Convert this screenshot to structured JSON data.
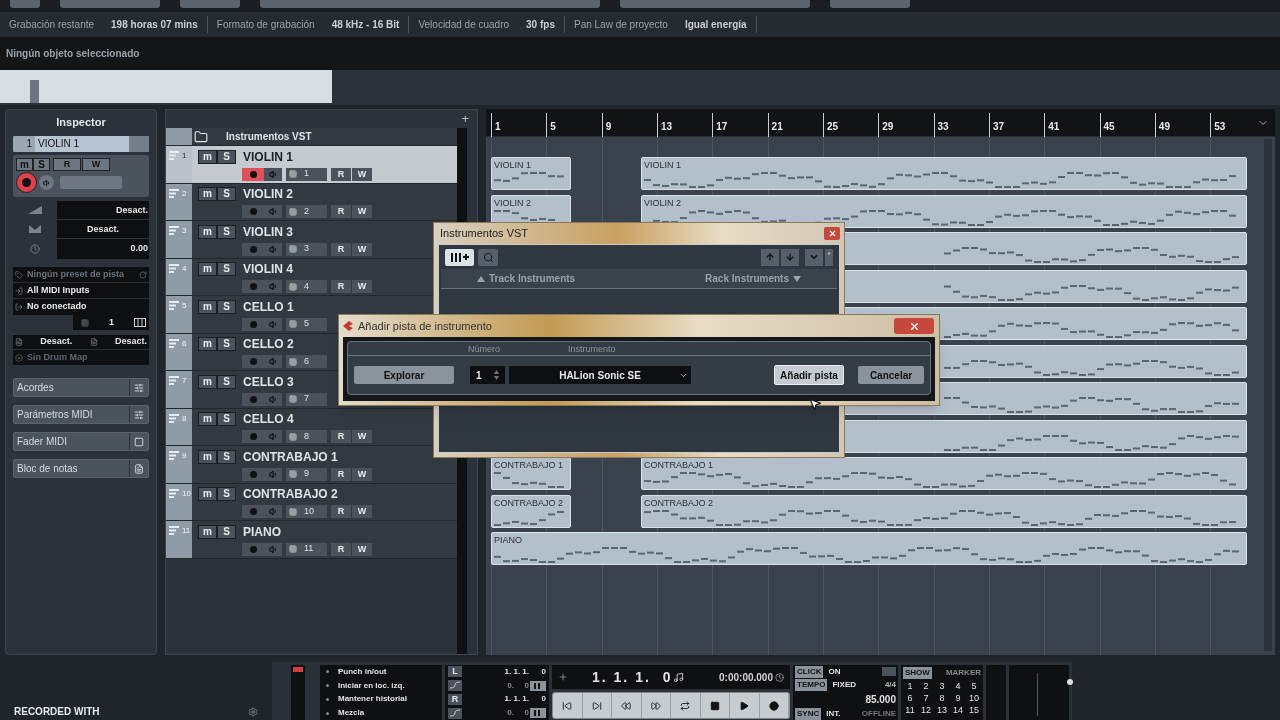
{
  "info_bar": [
    {
      "label": "Grabación restante",
      "value": "198 horas 07 mins"
    },
    {
      "label": "Formato de grabación",
      "value": "48 kHz - 16 Bit"
    },
    {
      "label": "Velocidad de cuadro",
      "value": "30 fps"
    },
    {
      "label": "Pan Law de proyecto",
      "value": "Igual energía"
    }
  ],
  "selection_info": "Ningún objeto seleccionado",
  "inspector": {
    "title": "Inspector",
    "track_number": "1",
    "track_name": "VIOLIN 1",
    "buttons": {
      "mute": "m",
      "solo": "S",
      "read": "R",
      "write": "W"
    },
    "record_armed": true,
    "volume": "Desact.",
    "pan": "Desact.",
    "delay": "0.00",
    "preset": "Ningún preset de pista",
    "input": "All MIDI Inputs",
    "output": "No conectado",
    "channel": "1",
    "bank": "Desact.",
    "program": "Desact.",
    "drum_map": "Sin Drum Map",
    "sections": [
      "Acordes",
      "Parámetros MIDI",
      "Fader MIDI",
      "Bloc de notas"
    ]
  },
  "track_list": {
    "add": "+",
    "folder": "Instrumentos VST",
    "tracks": [
      {
        "number": "1",
        "name": "VIOLIN 1",
        "channel": "1",
        "selected": true,
        "record_armed": true,
        "buttons": {
          "mute": "m",
          "solo": "S",
          "read": "R",
          "write": "W"
        }
      },
      {
        "number": "2",
        "name": "VIOLIN 2",
        "channel": "2",
        "selected": false,
        "record_armed": false,
        "buttons": {
          "mute": "m",
          "solo": "S",
          "read": "R",
          "write": "W"
        }
      },
      {
        "number": "3",
        "name": "VIOLIN 3",
        "channel": "3",
        "selected": false,
        "record_armed": false,
        "buttons": {
          "mute": "m",
          "solo": "S",
          "read": "R",
          "write": "W"
        }
      },
      {
        "number": "4",
        "name": "VIOLIN 4",
        "channel": "4",
        "selected": false,
        "record_armed": false,
        "buttons": {
          "mute": "m",
          "solo": "S",
          "read": "R",
          "write": "W"
        }
      },
      {
        "number": "5",
        "name": "CELLO 1",
        "channel": "5",
        "selected": false,
        "record_armed": false,
        "buttons": {
          "mute": "m",
          "solo": "S"
        }
      },
      {
        "number": "6",
        "name": "CELLO 2",
        "channel": "6",
        "selected": false,
        "record_armed": false,
        "buttons": {
          "mute": "m",
          "solo": "S"
        }
      },
      {
        "number": "7",
        "name": "CELLO 3",
        "channel": "7",
        "selected": false,
        "record_armed": false,
        "buttons": {
          "mute": "m",
          "solo": "S"
        }
      },
      {
        "number": "8",
        "name": "CELLO 4",
        "channel": "8",
        "selected": false,
        "record_armed": false,
        "buttons": {
          "mute": "m",
          "solo": "S",
          "read": "R",
          "write": "W"
        }
      },
      {
        "number": "9",
        "name": "CONTRABAJO 1",
        "channel": "9",
        "selected": false,
        "record_armed": false,
        "buttons": {
          "mute": "m",
          "solo": "S",
          "read": "R",
          "write": "W"
        }
      },
      {
        "number": "10",
        "name": "CONTRABAJO 2",
        "channel": "10",
        "selected": false,
        "record_armed": false,
        "buttons": {
          "mute": "m",
          "solo": "S",
          "read": "R",
          "write": "W"
        }
      },
      {
        "number": "11",
        "name": "PIANO",
        "channel": "11",
        "selected": false,
        "record_armed": false,
        "buttons": {
          "mute": "m",
          "solo": "S",
          "read": "R",
          "write": "W"
        }
      }
    ]
  },
  "arrange": {
    "ruler": [
      "1",
      "5",
      "9",
      "13",
      "17",
      "21",
      "25",
      "29",
      "33",
      "37",
      "41",
      "45",
      "49",
      "53"
    ],
    "lanes": [
      {
        "clips": [
          {
            "kind": "intro",
            "name": "VIOLIN 1"
          },
          {
            "kind": "main",
            "name": "VIOLIN 1"
          }
        ]
      },
      {
        "clips": [
          {
            "kind": "intro",
            "name": "VIOLIN 2"
          },
          {
            "kind": "main",
            "name": "VIOLIN 2"
          }
        ]
      },
      {
        "clips": [
          {
            "kind": "main"
          }
        ]
      },
      {
        "clips": [
          {
            "kind": "main"
          }
        ]
      },
      {
        "clips": [
          {
            "kind": "main"
          }
        ]
      },
      {
        "clips": [
          {
            "kind": "main"
          }
        ]
      },
      {
        "clips": [
          {
            "kind": "main"
          }
        ]
      },
      {
        "clips": [
          {
            "kind": "main"
          }
        ]
      },
      {
        "clips": [
          {
            "kind": "intro",
            "name": "CONTRABAJO 1"
          },
          {
            "kind": "main",
            "name": "CONTRABAJO 1"
          }
        ]
      },
      {
        "clips": [
          {
            "kind": "intro",
            "name": "CONTRABAJO 2"
          },
          {
            "kind": "main",
            "name": "CONTRABAJO 2"
          }
        ]
      },
      {
        "clips": [
          {
            "kind": "full",
            "name": "PIANO"
          }
        ]
      }
    ]
  },
  "vst_window": {
    "title": "Instrumentos VST",
    "columns": [
      "Track Instruments",
      "Rack Instruments"
    ],
    "menu_mark": "*"
  },
  "add_track_dialog": {
    "title": "Añadir pista de instrumento",
    "number_label": "Número",
    "instrument_label": "Instrumento",
    "browse": "Explorar",
    "number": "1",
    "instrument": "HALion Sonic SE",
    "add": "Añadir pista",
    "cancel": "Cancelar"
  },
  "transport": {
    "punch": [
      "Punch in/out",
      "Iniciar en loc. izq.",
      "Mantener historial",
      "Mezcla"
    ],
    "locators": [
      {
        "label": "L",
        "position": "1. 1. 1.",
        "ticks": "0",
        "sub": "0.",
        "sub_ticks": "0"
      },
      {
        "label": "R",
        "position": "1. 1. 1.",
        "ticks": "0",
        "sub": "0.",
        "sub_ticks": "0"
      }
    ],
    "position": "1. 1. 1.",
    "position_ticks": "0",
    "time": "0:00:00.000",
    "click": {
      "label": "CLICK",
      "value": "ON"
    },
    "tempo": {
      "label": "TEMPO",
      "value": "FIXED",
      "signature": "4/4",
      "bpm": "85.000"
    },
    "sync": {
      "label": "SYNC",
      "value": "INT.",
      "status": "OFFLINE"
    },
    "markers": {
      "show": "SHOW",
      "label": "MARKER",
      "numbers": [
        "1",
        "2",
        "3",
        "4",
        "5",
        "6",
        "7",
        "8",
        "9",
        "10",
        "11",
        "12",
        "13",
        "14",
        "15"
      ]
    }
  },
  "footer": "RECORDED WITH"
}
